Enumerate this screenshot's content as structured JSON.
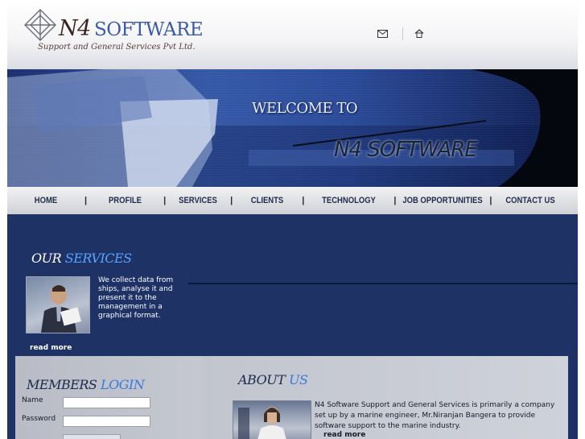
{
  "header": {
    "logo_n4": "N4",
    "logo_software": "SOFTWARE",
    "logo_subtitle": "Support and General Services Pvt Ltd.",
    "icons": [
      "mail-icon",
      "home-icon"
    ]
  },
  "banner": {
    "welcome": "WELCOME TO",
    "brand": "N4 SOFTWARE"
  },
  "nav": {
    "items": [
      "HOME",
      "PROFILE",
      "SERVICES",
      "CLIENTS",
      "TECHNOLOGY",
      "JOB OPPORTUNITIES",
      "CONTACT US"
    ],
    "separator": "|"
  },
  "services": {
    "title_a": "OUR",
    "title_b": "SERVICES",
    "text": "We collect data from ships, analyse it and present it to the management in a graphical format.",
    "read_more": "read more"
  },
  "members": {
    "title_a": "MEMBERS",
    "title_b": "LOGIN",
    "name_label": "Name",
    "password_label": "Password",
    "name_value": "",
    "password_value": ""
  },
  "about": {
    "title_a": "ABOUT",
    "title_b": "US",
    "text": "N4 Software Support and General Services is primarily a company set up by a marine engineer, Mr.Niranjan Bangera to provide software support to the marine industry.",
    "read_more": "read more"
  },
  "colors": {
    "page_bg": "#1e3266",
    "accent_blue": "#5aa2ff",
    "panel_gray": "#c5c8d1"
  }
}
